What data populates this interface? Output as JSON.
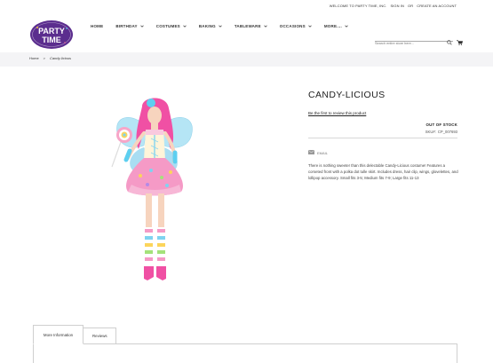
{
  "topbar": {
    "welcome": "WELCOME TO PARTY TIME, INC.",
    "sign_in": "SIGN IN",
    "or": "OR",
    "create_account": "CREATE AN ACCOUNT"
  },
  "logo": {
    "line1": "PARTY",
    "line2": "TIME",
    "brand_color": "#5b2d8e"
  },
  "nav": {
    "items": [
      {
        "label": "HOME",
        "dropdown": false
      },
      {
        "label": "BIRTHDAY",
        "dropdown": true
      },
      {
        "label": "COSTUMES",
        "dropdown": true
      },
      {
        "label": "BAKING",
        "dropdown": true
      },
      {
        "label": "TABLEWARE",
        "dropdown": true
      },
      {
        "label": "OCCASIONS",
        "dropdown": true
      },
      {
        "label": "MORE....",
        "dropdown": true
      }
    ]
  },
  "search": {
    "placeholder": "Search entire store here...",
    "icon": "search-icon"
  },
  "cart": {
    "icon": "cart-icon"
  },
  "breadcrumb": {
    "home": "Home",
    "separator": ">",
    "current": "Candy-licious"
  },
  "product": {
    "title": "CANDY-LICIOUS",
    "review_link": "Be the first to review this product",
    "stock_status": "OUT OF STOCK",
    "sku_label": "SKU#:",
    "sku_value": "CP_007693",
    "email_label": "EMAIL",
    "description": "There is nothing sweeter than this delectable Candy-Licious costume! Features a corseted front with a polka dot tulle skirt. Includes dress, hair clip, wings, glovelettes, and lollipop accessory. Small fits 3-5; Medium fits 7-9; Large fits 11-13"
  },
  "tabs": {
    "more_information": "More Information",
    "reviews": "Reviews"
  }
}
